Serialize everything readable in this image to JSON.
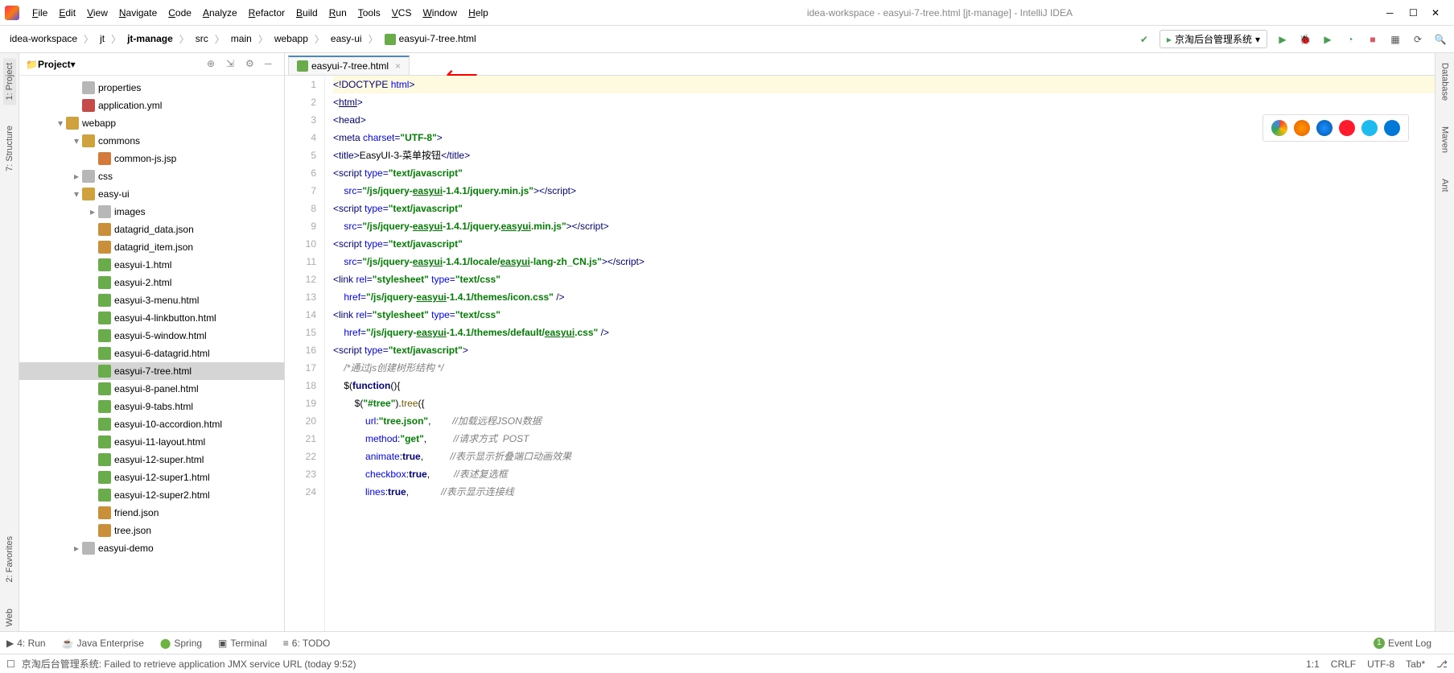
{
  "window": {
    "title": "idea-workspace - easyui-7-tree.html [jt-manage] - IntelliJ IDEA"
  },
  "menus": [
    "File",
    "Edit",
    "View",
    "Navigate",
    "Code",
    "Analyze",
    "Refactor",
    "Build",
    "Run",
    "Tools",
    "VCS",
    "Window",
    "Help"
  ],
  "breadcrumbs": [
    "idea-workspace",
    "jt",
    "jt-manage",
    "src",
    "main",
    "webapp",
    "easy-ui",
    "easyui-7-tree.html"
  ],
  "run_config": "京淘后台管理系统",
  "project_title": "Project",
  "tree": [
    {
      "depth": 3,
      "icon": "folder",
      "label": "properties",
      "arrow": ""
    },
    {
      "depth": 3,
      "icon": "yml",
      "label": "application.yml",
      "arrow": ""
    },
    {
      "depth": 2,
      "icon": "folder-open",
      "label": "webapp",
      "arrow": "▾"
    },
    {
      "depth": 3,
      "icon": "folder-open",
      "label": "commons",
      "arrow": "▾"
    },
    {
      "depth": 4,
      "icon": "jsp",
      "label": "common-js.jsp",
      "arrow": ""
    },
    {
      "depth": 3,
      "icon": "folder",
      "label": "css",
      "arrow": "▸"
    },
    {
      "depth": 3,
      "icon": "folder-open",
      "label": "easy-ui",
      "arrow": "▾"
    },
    {
      "depth": 4,
      "icon": "folder",
      "label": "images",
      "arrow": "▸"
    },
    {
      "depth": 4,
      "icon": "json",
      "label": "datagrid_data.json",
      "arrow": ""
    },
    {
      "depth": 4,
      "icon": "json",
      "label": "datagrid_item.json",
      "arrow": ""
    },
    {
      "depth": 4,
      "icon": "html",
      "label": "easyui-1.html",
      "arrow": ""
    },
    {
      "depth": 4,
      "icon": "html",
      "label": "easyui-2.html",
      "arrow": ""
    },
    {
      "depth": 4,
      "icon": "html",
      "label": "easyui-3-menu.html",
      "arrow": ""
    },
    {
      "depth": 4,
      "icon": "html",
      "label": "easyui-4-linkbutton.html",
      "arrow": ""
    },
    {
      "depth": 4,
      "icon": "html",
      "label": "easyui-5-window.html",
      "arrow": ""
    },
    {
      "depth": 4,
      "icon": "html",
      "label": "easyui-6-datagrid.html",
      "arrow": ""
    },
    {
      "depth": 4,
      "icon": "html",
      "label": "easyui-7-tree.html",
      "arrow": "",
      "selected": true
    },
    {
      "depth": 4,
      "icon": "html",
      "label": "easyui-8-panel.html",
      "arrow": ""
    },
    {
      "depth": 4,
      "icon": "html",
      "label": "easyui-9-tabs.html",
      "arrow": ""
    },
    {
      "depth": 4,
      "icon": "html",
      "label": "easyui-10-accordion.html",
      "arrow": ""
    },
    {
      "depth": 4,
      "icon": "html",
      "label": "easyui-11-layout.html",
      "arrow": ""
    },
    {
      "depth": 4,
      "icon": "html",
      "label": "easyui-12-super.html",
      "arrow": ""
    },
    {
      "depth": 4,
      "icon": "html",
      "label": "easyui-12-super1.html",
      "arrow": ""
    },
    {
      "depth": 4,
      "icon": "html",
      "label": "easyui-12-super2.html",
      "arrow": ""
    },
    {
      "depth": 4,
      "icon": "json",
      "label": "friend.json",
      "arrow": ""
    },
    {
      "depth": 4,
      "icon": "json",
      "label": "tree.json",
      "arrow": ""
    },
    {
      "depth": 3,
      "icon": "folder",
      "label": "easyui-demo",
      "arrow": "▸"
    }
  ],
  "tab": {
    "label": "easyui-7-tree.html"
  },
  "code": {
    "lines": [
      {
        "n": 1,
        "html": "<span class='tag'>&lt;!DOCTYPE</span> <span class='attr'>html</span><span class='tag'>&gt;</span>",
        "cur": true
      },
      {
        "n": 2,
        "html": "<span class='tag'>&lt;<u>html</u>&gt;</span>"
      },
      {
        "n": 3,
        "html": "<span class='tag'>&lt;head&gt;</span>"
      },
      {
        "n": 4,
        "html": "<span class='tag'>&lt;meta </span><span class='attr'>charset=</span><span class='str'>\"UTF-8\"</span><span class='tag'>&gt;</span>"
      },
      {
        "n": 5,
        "html": "<span class='tag'>&lt;title&gt;</span>EasyUI-3-菜单按钮<span class='tag'>&lt;/title&gt;</span>"
      },
      {
        "n": 6,
        "html": "<span class='tag'>&lt;script </span><span class='attr'>type=</span><span class='str'>\"text/javascript\"</span>"
      },
      {
        "n": 7,
        "html": "    <span class='attr'>src=</span><span class='str'>\"/js/jquery-<u>easyui</u>-1.4.1/jquery.min.js\"</span><span class='tag'>&gt;&lt;/script&gt;</span>"
      },
      {
        "n": 8,
        "html": "<span class='tag'>&lt;script </span><span class='attr'>type=</span><span class='str'>\"text/javascript\"</span>"
      },
      {
        "n": 9,
        "html": "    <span class='attr'>src=</span><span class='str'>\"/js/jquery-<u>easyui</u>-1.4.1/jquery.<u>easyui</u>.min.js\"</span><span class='tag'>&gt;&lt;/script&gt;</span>"
      },
      {
        "n": 10,
        "html": "<span class='tag'>&lt;script </span><span class='attr'>type=</span><span class='str'>\"text/javascript\"</span>"
      },
      {
        "n": 11,
        "html": "    <span class='attr'>src=</span><span class='str'>\"/js/jquery-<u>easyui</u>-1.4.1/locale/<u>easyui</u>-lang-zh_CN.js\"</span><span class='tag'>&gt;&lt;/script&gt;</span>"
      },
      {
        "n": 12,
        "html": "<span class='tag'>&lt;link </span><span class='attr'>rel=</span><span class='str'>\"stylesheet\"</span> <span class='attr'>type=</span><span class='str'>\"text/css\"</span>"
      },
      {
        "n": 13,
        "html": "    <span class='attr'>href=</span><span class='str'>\"/js/jquery-<u>easyui</u>-1.4.1/themes/icon.css\"</span> <span class='tag'>/&gt;</span>"
      },
      {
        "n": 14,
        "html": "<span class='tag'>&lt;link </span><span class='attr'>rel=</span><span class='str'>\"stylesheet\"</span> <span class='attr'>type=</span><span class='str'>\"text/css\"</span>"
      },
      {
        "n": 15,
        "html": "    <span class='attr'>href=</span><span class='str'>\"/js/jquery-<u>easyui</u>-1.4.1/themes/default/<u>easyui</u>.css\"</span> <span class='tag'>/&gt;</span>"
      },
      {
        "n": 16,
        "html": "<span class='tag'>&lt;script </span><span class='attr'>type=</span><span class='str'>\"text/javascript\"</span><span class='tag'>&gt;</span>"
      },
      {
        "n": 17,
        "html": "    <span class='cmt'>/*通过js创建树形结构 */</span>"
      },
      {
        "n": 18,
        "html": "    $(<span class='kw'>function</span>(){"
      },
      {
        "n": 19,
        "html": "        $(<span class='str'>\"#tree\"</span>).<span class='fn'>tree</span>({"
      },
      {
        "n": 20,
        "html": "            <span class='attr'>url</span>:<span class='str'>\"tree.json\"</span>,        <span class='cmt'>//加载远程JSON数据</span>"
      },
      {
        "n": 21,
        "html": "            <span class='attr'>method</span>:<span class='str'>\"get\"</span>,          <span class='cmt'>//请求方式  POST</span>"
      },
      {
        "n": 22,
        "html": "            <span class='attr'>animate</span>:<span class='kw'>true</span>,          <span class='cmt'>//表示显示折叠端口动画效果</span>"
      },
      {
        "n": 23,
        "html": "            <span class='attr'>checkbox</span>:<span class='kw'>true</span>,         <span class='cmt'>//表述复选框</span>"
      },
      {
        "n": 24,
        "html": "            <span class='attr'>lines</span>:<span class='kw'>true</span>,            <span class='cmt'>//表示显示连接线</span>"
      }
    ]
  },
  "left_tabs": [
    "1: Project",
    "7: Structure",
    "2: Favorites",
    "Web"
  ],
  "right_tabs": [
    "Database",
    "Maven",
    "Ant"
  ],
  "bottom_tabs": [
    "4: Run",
    "Java Enterprise",
    "Spring",
    "Terminal",
    "6: TODO"
  ],
  "event_log": "Event Log",
  "status": {
    "msg": "京淘后台管理系统: Failed to retrieve application JMX service URL (today 9:52)",
    "pos": "1:1",
    "crlf": "CRLF",
    "enc": "UTF-8",
    "tab": "Tab*",
    "git": "⎇"
  },
  "browsers": [
    "chrome",
    "firefox",
    "safari",
    "opera",
    "ie",
    "edge"
  ]
}
